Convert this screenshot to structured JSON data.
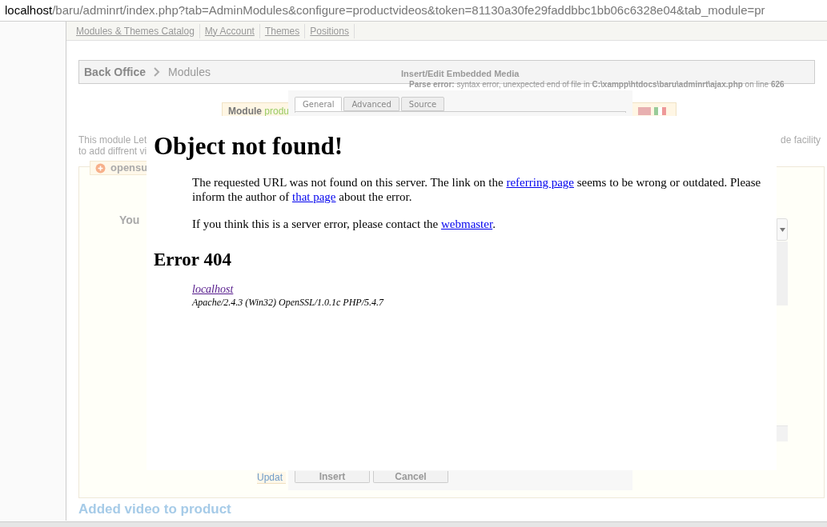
{
  "address_bar": {
    "host": "localhost",
    "path": "/baru/adminrt/index.php?tab=AdminModules&configure=productvideos&token=81130a30fe29faddbbc1bb06c6328e04&tab_module=pr"
  },
  "nav_links": [
    "Modules & Themes Catalog",
    "My Account",
    "Themes",
    "Positions"
  ],
  "breadcrumb": [
    "Back Office",
    "Modules"
  ],
  "parse_error": "**Parse error:** syntax error, unexpected end of file in **C:\\xampp\\htdocs\\baru\\adminrt\\ajax.php** on line **626**",
  "dialog": {
    "title": "Insert/Edit Embedded Media",
    "tabs": [
      {
        "label": "General",
        "selected": true
      },
      {
        "label": "Advanced",
        "selected": false
      },
      {
        "label": "Source",
        "selected": false
      }
    ],
    "buttons": [
      "Insert",
      "Cancel"
    ]
  },
  "module_header": {
    "label": "Module",
    "name": "produ"
  },
  "description": {
    "lines": [
      "This module Let",
      "to add diffrent vi"
    ],
    "tail": "de facility"
  },
  "fieldset": {
    "legend": "opensu",
    "text": "You",
    "link": "Updat"
  },
  "footer_heading": "Added video to product",
  "error_page": {
    "title": "Object not found!",
    "paragraphs": [
      [
        {
          "kind": "text",
          "text": "The requested URL was not found on this server. The link on the "
        },
        {
          "kind": "link",
          "text": "referring page"
        },
        {
          "kind": "text",
          "text": " seems to be wrong or outdated. Please inform the author of "
        },
        {
          "kind": "link",
          "text": "that page"
        },
        {
          "kind": "text",
          "text": " about the error."
        }
      ],
      [
        {
          "kind": "text",
          "text": "If you think this is a server error, please contact the "
        },
        {
          "kind": "link",
          "text": "webmaster"
        },
        {
          "kind": "text",
          "text": "."
        }
      ]
    ],
    "heading": "Error 404",
    "address_link": "localhost",
    "server": "Apache/2.4.3 (Win32) OpenSSL/1.0.1c PHP/5.4.7"
  }
}
